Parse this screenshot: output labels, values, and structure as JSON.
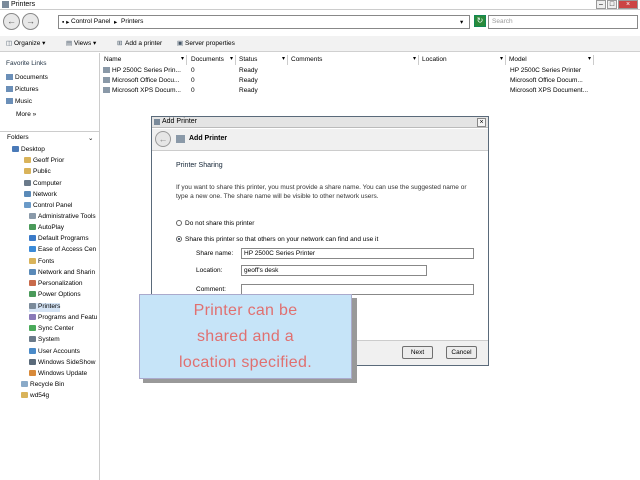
{
  "window": {
    "title": "Printers"
  },
  "address": {
    "path": [
      "Control Panel",
      "Printers"
    ],
    "search_placeholder": "Search"
  },
  "toolbar": {
    "organize": "Organize",
    "views": "Views",
    "add_printer": "Add a printer",
    "server_properties": "Server properties"
  },
  "favorites": {
    "title": "Favorite Links",
    "items": [
      "Documents",
      "Pictures",
      "Music"
    ],
    "more": "More"
  },
  "folders": {
    "title": "Folders",
    "tree": [
      "Desktop",
      "Geoff Prior",
      "Public",
      "Computer",
      "Network",
      "Control Panel",
      "Administrative Tools",
      "AutoPlay",
      "Default Programs",
      "Ease of Access Cen",
      "Fonts",
      "Network and Sharin",
      "Personalization",
      "Power Options",
      "Printers",
      "Programs and Featu",
      "Sync Center",
      "System",
      "User Accounts",
      "Windows SideShow",
      "Windows Update",
      "Recycle Bin",
      "wd54g"
    ]
  },
  "columns": [
    "Name",
    "Documents",
    "Status",
    "Comments",
    "Location",
    "Model"
  ],
  "printers": [
    {
      "name": "HP 2500C Series Prin...",
      "documents": "0",
      "status": "Ready",
      "model": "HP 2500C Series Printer"
    },
    {
      "name": "Microsoft Office Docu...",
      "documents": "0",
      "status": "Ready",
      "model": "Microsoft Office Docum..."
    },
    {
      "name": "Microsoft XPS Docum...",
      "documents": "0",
      "status": "Ready",
      "model": "Microsoft XPS Document..."
    }
  ],
  "dialog": {
    "title": "Add Printer",
    "header": "Add Printer",
    "section_title": "Printer Sharing",
    "description": "If you want to share this printer, you must provide a share name. You can use the suggested name or type a new one. The share name will be visible to other network users.",
    "option_no_share": "Do not share this printer",
    "option_share": "Share this printer so that others on your network can find and use it",
    "share_name_label": "Share name:",
    "share_name_value": "HP 2500C Series Printer",
    "location_label": "Location:",
    "location_value": "geoff's desk",
    "comment_label": "Comment:",
    "comment_value": "",
    "next": "Next",
    "cancel": "Cancel"
  },
  "callout": {
    "lines": [
      "Printer can be",
      "shared and a",
      "location specified."
    ]
  }
}
